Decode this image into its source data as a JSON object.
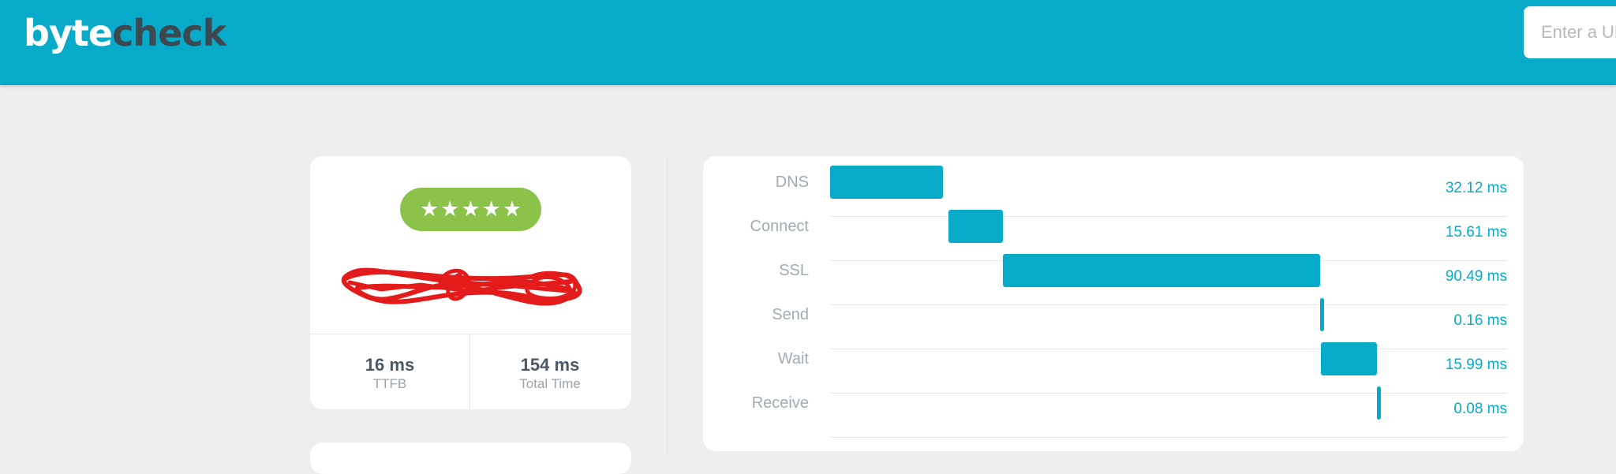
{
  "header": {
    "logo_part1": "byte",
    "logo_part2": "check",
    "url_placeholder": "Enter a URL"
  },
  "summary": {
    "rating_stars": 5,
    "ttfb_value": "16 ms",
    "ttfb_label": "TTFB",
    "total_value": "154 ms",
    "total_label": "Total Time"
  },
  "timing": {
    "rows": [
      {
        "label": "DNS",
        "start_ms": 0,
        "duration_ms": 32.12,
        "display": "32.12 ms"
      },
      {
        "label": "Connect",
        "start_ms": 33.73,
        "duration_ms": 15.61,
        "display": "15.61 ms"
      },
      {
        "label": "SSL",
        "start_ms": 49.34,
        "duration_ms": 90.49,
        "display": "90.49 ms"
      },
      {
        "label": "Send",
        "start_ms": 139.83,
        "duration_ms": 0.16,
        "display": "0.16 ms"
      },
      {
        "label": "Wait",
        "start_ms": 139.99,
        "duration_ms": 15.99,
        "display": "15.99 ms"
      },
      {
        "label": "Receive",
        "start_ms": 155.98,
        "duration_ms": 0.08,
        "display": "0.08 ms"
      }
    ],
    "bar_color": "#07aac8"
  },
  "colors": {
    "brand": "#07aac8",
    "rating_green": "#8bc34a"
  }
}
